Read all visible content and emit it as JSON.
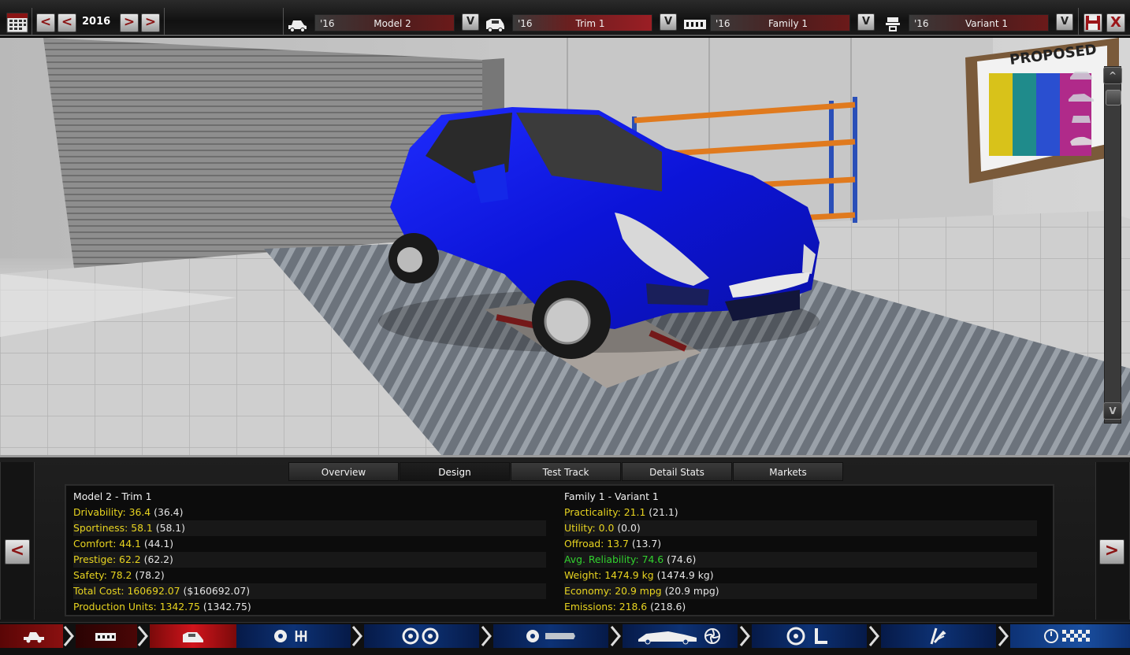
{
  "toolbar": {
    "year": "2016",
    "prev_label": "<",
    "next_label": ">",
    "selectors": [
      {
        "year": "'16",
        "name": "Model 2",
        "icon": "car-model-icon"
      },
      {
        "year": "'16",
        "name": "Trim 1",
        "icon": "car-trim-icon"
      },
      {
        "year": "'16",
        "name": "Family 1",
        "icon": "engine-family-icon"
      },
      {
        "year": "'16",
        "name": "Variant 1",
        "icon": "engine-variant-icon"
      }
    ],
    "dropdown_label": "V",
    "close_label": "X"
  },
  "viewport": {
    "scroll_up": "^",
    "scroll_down": "V"
  },
  "tabs": [
    "Overview",
    "Design",
    "Test Track",
    "Detail Stats",
    "Markets"
  ],
  "active_tab": "Design",
  "panel": {
    "prev_label": "<",
    "next_label": ">"
  },
  "stats": {
    "left_header": "Model 2 - Trim 1",
    "left": [
      {
        "label": "Drivability: 36.4",
        "paren": "(36.4)"
      },
      {
        "label": "Sportiness: 58.1",
        "paren": "(58.1)"
      },
      {
        "label": "Comfort: 44.1",
        "paren": "(44.1)"
      },
      {
        "label": "Prestige: 62.2",
        "paren": "(62.2)"
      },
      {
        "label": "Safety: 78.2",
        "paren": "(78.2)"
      },
      {
        "label": "Total Cost: 160692.07",
        "paren": "($160692.07)"
      },
      {
        "label": "Production Units: 1342.75",
        "paren": "(1342.75)"
      }
    ],
    "right_header": "Family 1 - Variant 1",
    "right": [
      {
        "label": "Practicality: 21.1",
        "paren": "(21.1)"
      },
      {
        "label": "Utility: 0.0",
        "paren": "(0.0)"
      },
      {
        "label": "Offroad: 13.7",
        "paren": "(13.7)"
      },
      {
        "label": "Avg. Reliability: 74.6",
        "paren": "(74.6)"
      },
      {
        "label": "Weight: 1474.9 kg",
        "paren": "(1474.9 kg)"
      },
      {
        "label": "Economy: 20.9 mpg",
        "paren": "(20.9 mpg)"
      },
      {
        "label": "Emissions: 218.6",
        "paren": "(218.6)"
      }
    ],
    "highlight_color": "#31d22e",
    "label_color": "#e8d420"
  },
  "bottom_nav": [
    {
      "icon": "chassis-icon",
      "color": "#7a0a0a"
    },
    {
      "icon": "frame-icon",
      "color": "#5a0808"
    },
    {
      "icon": "car-body-icon",
      "color": "#c0141c"
    },
    {
      "icon": "engine-gearbox-icon",
      "color": "#0b2a6a"
    },
    {
      "icon": "wheels-brakes-icon",
      "color": "#0b2a6a"
    },
    {
      "icon": "tires-icon",
      "color": "#0b2a6a"
    },
    {
      "icon": "aero-cooling-icon",
      "color": "#0b2a6a"
    },
    {
      "icon": "interior-icon",
      "color": "#0b2a6a"
    },
    {
      "icon": "suspension-icon",
      "color": "#0b2a6a"
    },
    {
      "icon": "testing-flag-icon",
      "color": "#1a4fa0"
    }
  ]
}
